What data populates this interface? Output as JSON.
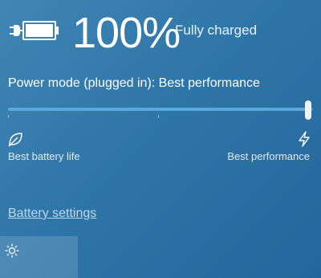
{
  "battery": {
    "icon": "battery-full-charging-icon",
    "percent_text": "100%",
    "level": 1.0,
    "status": "Fully charged"
  },
  "power_mode": {
    "title": "Power mode (plugged in): Best performance",
    "slider": {
      "value": 1.0,
      "ticks": [
        0.5
      ],
      "min_label": "Best battery life",
      "max_label": "Best performance",
      "min_icon": "leaf-icon",
      "max_icon": "lightning-bolt-icon"
    }
  },
  "links": {
    "battery_settings": "Battery settings"
  },
  "quick_actions": {
    "brightness_icon": "brightness-sun-icon"
  },
  "colors": {
    "background_start": "#3f86b4",
    "background_end": "#23669b",
    "track": "#4a97ce",
    "link": "#bcd6ea"
  }
}
